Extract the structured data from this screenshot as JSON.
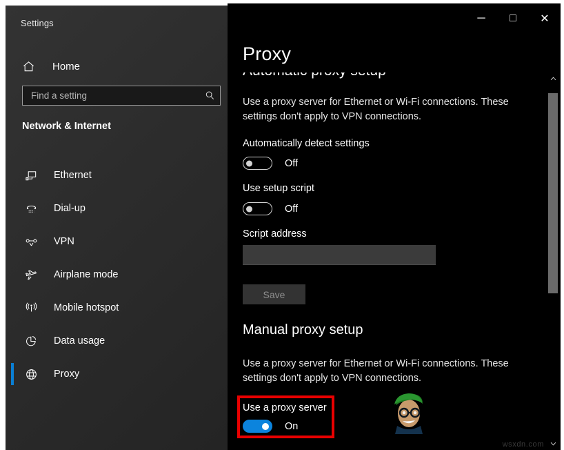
{
  "window": {
    "app_title": "Settings",
    "controls": [
      {
        "name": "minimize",
        "glyph": "─"
      },
      {
        "name": "maximize",
        "glyph": "□"
      },
      {
        "name": "close",
        "glyph": "✕"
      }
    ]
  },
  "sidebar": {
    "home_label": "Home",
    "search": {
      "placeholder": "Find a setting",
      "value": ""
    },
    "category": "Network & Internet",
    "items": [
      {
        "label": "Ethernet",
        "icon": "ethernet-icon",
        "selected": false
      },
      {
        "label": "Dial-up",
        "icon": "dialup-icon",
        "selected": false
      },
      {
        "label": "VPN",
        "icon": "vpn-icon",
        "selected": false
      },
      {
        "label": "Airplane mode",
        "icon": "airplane-icon",
        "selected": false
      },
      {
        "label": "Mobile hotspot",
        "icon": "hotspot-icon",
        "selected": false
      },
      {
        "label": "Data usage",
        "icon": "data-usage-icon",
        "selected": false
      },
      {
        "label": "Proxy",
        "icon": "globe-icon",
        "selected": true
      }
    ]
  },
  "main": {
    "page_title": "Proxy",
    "clipped_heading": "Automatic proxy setup",
    "automatic": {
      "description": "Use a proxy server for Ethernet or Wi-Fi connections. These settings don't apply to VPN connections.",
      "auto_detect_label": "Automatically detect settings",
      "auto_detect_state": "Off",
      "setup_script_label": "Use setup script",
      "setup_script_state": "Off",
      "script_address_label": "Script address",
      "script_address_value": "",
      "save_label": "Save"
    },
    "manual": {
      "heading": "Manual proxy setup",
      "description": "Use a proxy server for Ethernet or Wi-Fi connections. These settings don't apply to VPN connections.",
      "use_proxy_label": "Use a proxy server",
      "use_proxy_state": "On"
    }
  },
  "watermark": {
    "text": "wsxdn.com"
  },
  "colors": {
    "accent_blue": "#0c84dd",
    "highlight_red": "#e80000",
    "sidebar_bg": "#2c2c2c",
    "content_bg": "#000000"
  }
}
